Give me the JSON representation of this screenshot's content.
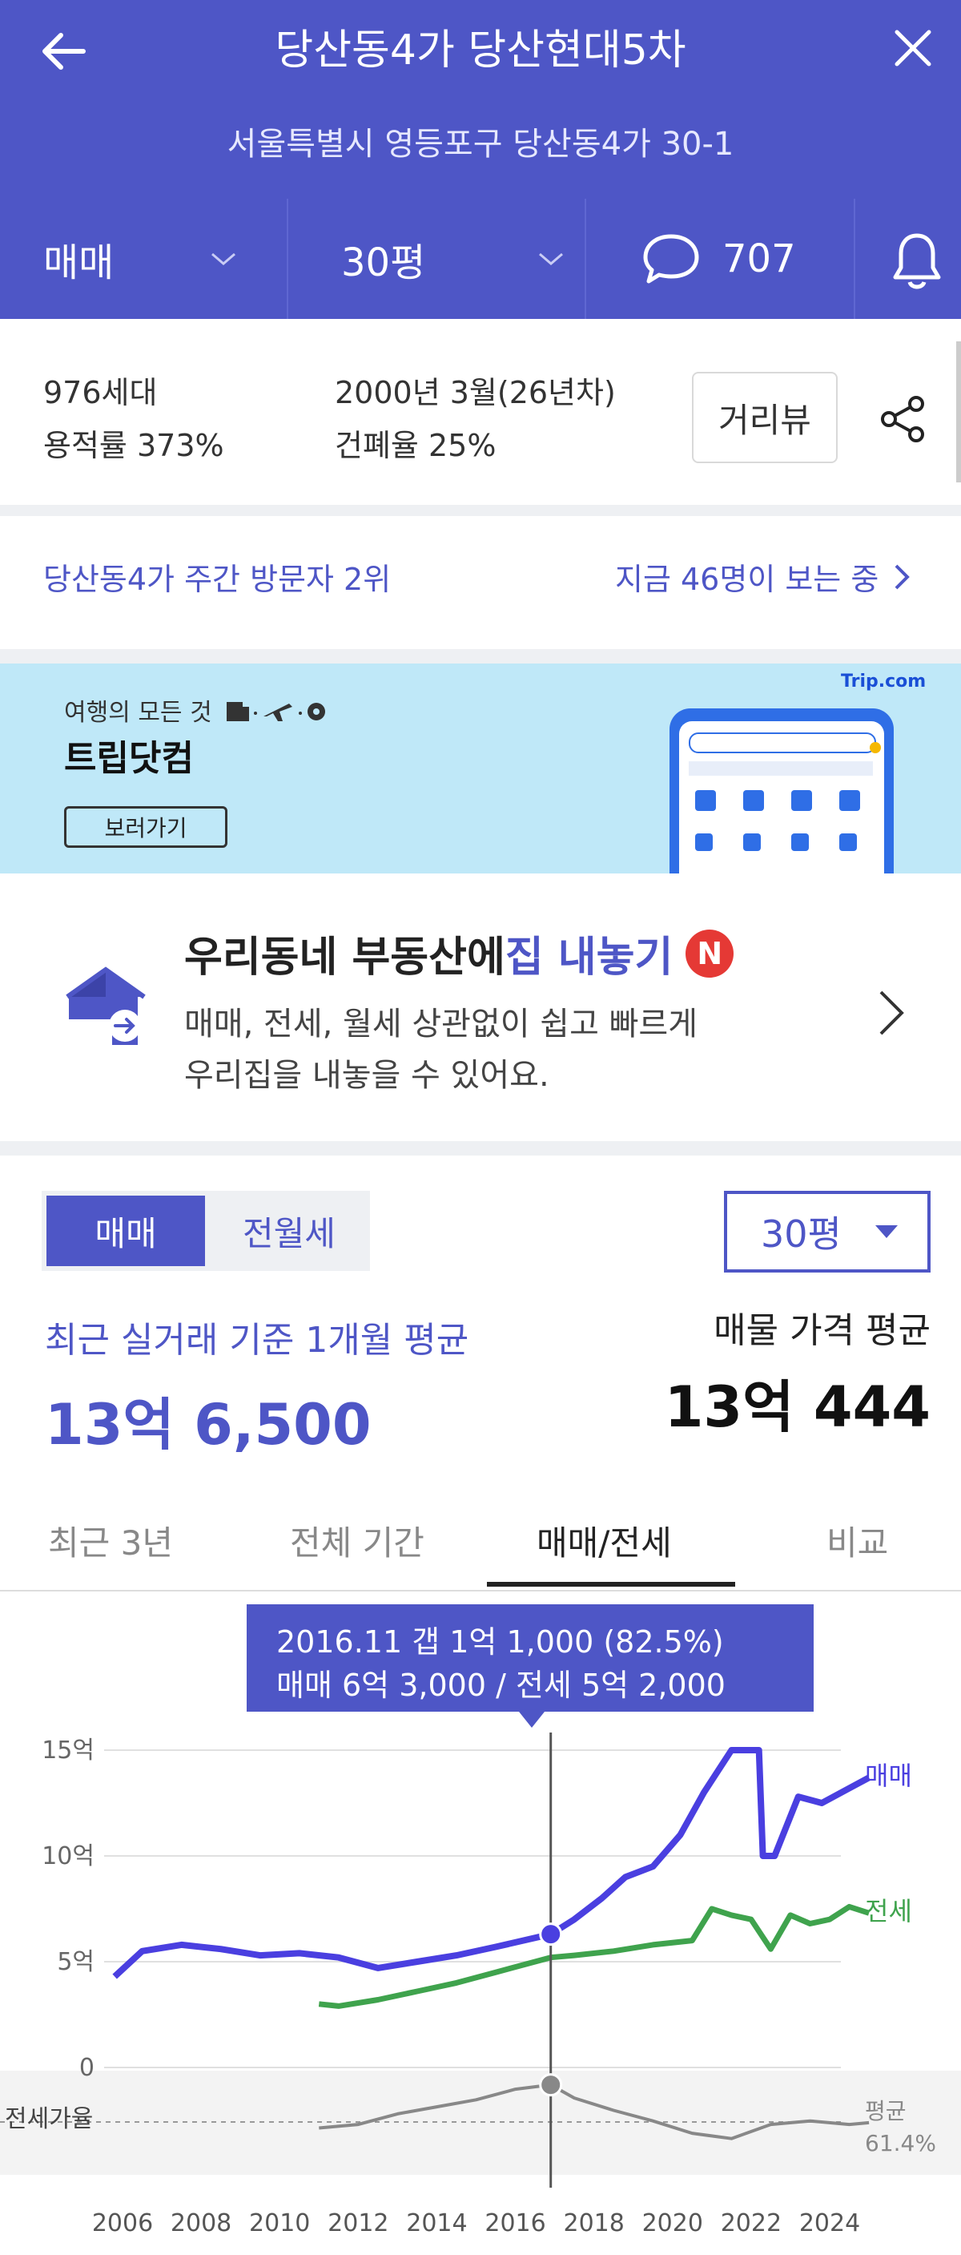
{
  "header": {
    "title": "당산동4가 당산현대5차",
    "address": "서울특별시 영등포구 당산동4가 30-1",
    "trade_type": "매매",
    "size": "30평",
    "comment_count": "707"
  },
  "info": {
    "households": "976세대",
    "floor_area_ratio": "용적률 373%",
    "built": "2000년 3월(26년차)",
    "coverage_ratio": "건폐율 25%",
    "road_view_button": "거리뷰"
  },
  "visitors": {
    "rank": "당산동4가 주간 방문자 2위",
    "now_viewing": "지금 46명이 보는 중"
  },
  "ad": {
    "small": "여행의 모든 것",
    "brand": "트립닷컴",
    "button": "보러가기",
    "logo": "Trip.com"
  },
  "listing": {
    "title_part1": "우리동네 부동산에 ",
    "title_part2": "집 내놓기",
    "badge": "N",
    "desc_line1": "매매, 전세, 월세 상관없이 쉽고 빠르게",
    "desc_line2": "우리집을 내놓을 수 있어요."
  },
  "market": {
    "tab_sale": "매매",
    "tab_rent": "전월세",
    "size_select": "30평",
    "recent_label": "최근 실거래 기준 1개월 평균",
    "recent_price": "13억 6,500",
    "listing_label": "매물 가격 평균",
    "listing_price": "13억 444"
  },
  "period_tabs": [
    "최근 3년",
    "전체 기간",
    "매매/전세",
    "비교"
  ],
  "tooltip": {
    "line1": "2016.11  갭 1억 1,000 (82.5%)",
    "line2": "매매 6억 3,000 / 전세 5억 2,000"
  },
  "chart_labels": {
    "sale": "매매",
    "jeonse": "전세",
    "ratio_axis": "전세가율",
    "avg_label": "평균",
    "avg_value": "61.4%"
  },
  "colors": {
    "brand": "#4e56c6",
    "sale": "#4a3fe0",
    "jeonse": "#3fa34d",
    "ratio": "#888888"
  },
  "chart_data": {
    "type": "line",
    "x_ticks": [
      "2006",
      "2008",
      "2010",
      "2012",
      "2014",
      "2016",
      "2018",
      "2020",
      "2022",
      "2024"
    ],
    "y_ticks": [
      "15억",
      "10억",
      "5억",
      "0"
    ],
    "ylim": [
      0,
      15
    ],
    "y_unit": "억",
    "series": [
      {
        "name": "매매",
        "x": [
          2005.8,
          2006.5,
          2007.5,
          2008.5,
          2009.5,
          2010.5,
          2011.5,
          2012.5,
          2013.5,
          2014.5,
          2015.5,
          2016.9,
          2017.5,
          2018.2,
          2018.8,
          2019.5,
          2020.2,
          2020.8,
          2021.5,
          2022.2,
          2022.3,
          2022.6,
          2023.2,
          2023.8,
          2024.5,
          2025.0
        ],
        "values": [
          4.3,
          5.5,
          5.8,
          5.6,
          5.3,
          5.4,
          5.2,
          4.7,
          5.0,
          5.3,
          5.7,
          6.3,
          7.0,
          8.0,
          9.0,
          9.5,
          11.0,
          13.0,
          15.0,
          15.0,
          10.0,
          10.0,
          12.8,
          12.5,
          13.2,
          13.7
        ]
      },
      {
        "name": "전세",
        "x": [
          2011.0,
          2011.5,
          2012.5,
          2013.5,
          2014.5,
          2015.5,
          2016.9,
          2017.5,
          2018.5,
          2019.5,
          2020.5,
          2021.0,
          2021.5,
          2022.0,
          2022.5,
          2023.0,
          2023.5,
          2024.0,
          2024.5,
          2025.0
        ],
        "values": [
          3.0,
          2.9,
          3.2,
          3.6,
          4.0,
          4.5,
          5.2,
          5.3,
          5.5,
          5.8,
          6.0,
          7.5,
          7.2,
          7.0,
          5.6,
          7.2,
          6.8,
          7.0,
          7.6,
          7.3
        ]
      },
      {
        "name": "전세가율",
        "x": [
          2011.0,
          2012.0,
          2013.0,
          2014.0,
          2015.0,
          2016.0,
          2016.9,
          2017.5,
          2018.5,
          2019.5,
          2020.5,
          2021.5,
          2022.5,
          2023.5,
          2024.5,
          2025.0
        ],
        "values": [
          58,
          60,
          66,
          70,
          74,
          80,
          82.5,
          75,
          68,
          62,
          55,
          52,
          60,
          62,
          60,
          61
        ]
      }
    ],
    "average_ratio": 61.4,
    "highlight": {
      "x": 2016.9,
      "sale": 6.3,
      "jeonse": 5.2,
      "ratio": 82.5
    }
  }
}
